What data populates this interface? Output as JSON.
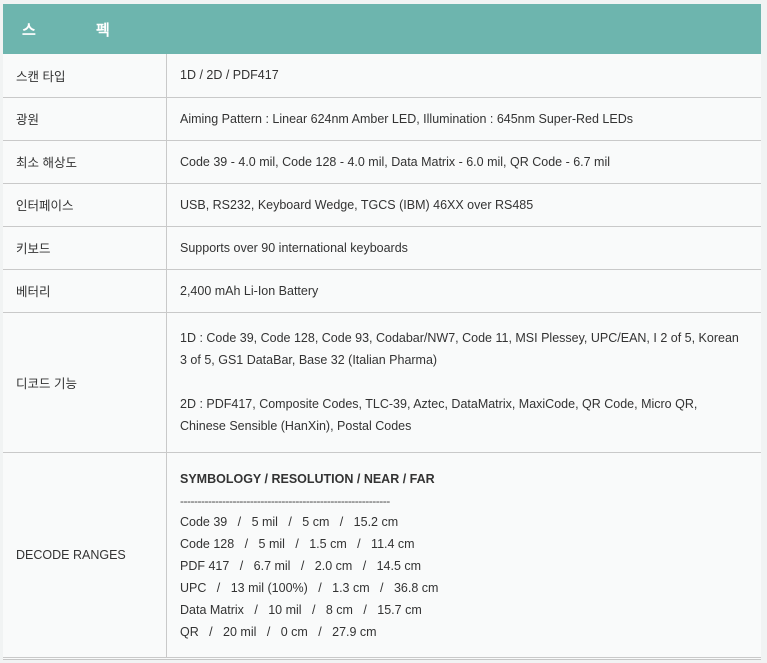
{
  "header": {
    "title": "스 펙"
  },
  "rows": [
    {
      "key": "스캔 타입",
      "value": "1D / 2D / PDF417"
    },
    {
      "key": "광원",
      "value": "Aiming Pattern : Linear 624nm Amber LED, Illumination : 645nm Super-Red LEDs"
    },
    {
      "key": "최소 해상도",
      "value": "Code 39 - 4.0 mil, Code 128 - 4.0 mil, Data Matrix - 6.0 mil, QR Code - 6.7 mil"
    },
    {
      "key": "인터페이스",
      "value": "USB, RS232, Keyboard Wedge, TGCS (IBM) 46XX over RS485"
    },
    {
      "key": "키보드",
      "value": "Supports over 90 international keyboards"
    },
    {
      "key": "베터리",
      "value": "2,400 mAh Li-Ion Battery"
    }
  ],
  "decode": {
    "key": "디코드 기능",
    "lines_1d": [
      "1D : Code 39, Code 128, Code 93, Codabar/NW7, Code 11, MSI Plessey, UPC/EAN, I 2 of 5, Korean",
      "3 of 5, GS1 DataBar, Base 32 (Italian Pharma)"
    ],
    "lines_2d": [
      "2D : PDF417, Composite Codes, TLC-39, Aztec, DataMatrix, MaxiCode, QR Code, Micro QR,",
      "Chinese Sensible (HanXin), Postal Codes"
    ]
  },
  "ranges": {
    "key": "DECODE RANGES",
    "title": "SYMBOLOGY / RESOLUTION / NEAR / FAR",
    "divider": "------------------------------------------------------------",
    "lines": [
      "Code 39   /   5 mil   /   5 cm   /   15.2 cm",
      "Code 128   /   5 mil   /   1.5 cm   /   11.4 cm",
      "PDF 417   /   6.7 mil   /   2.0 cm   /   14.5 cm",
      "UPC   /   13 mil (100%)   /   1.3 cm   /   36.8 cm",
      "Data Matrix   /   10 mil   /   8 cm   /   15.7 cm",
      "QR   /   20 mil   /   0 cm   /   27.9 cm"
    ]
  }
}
